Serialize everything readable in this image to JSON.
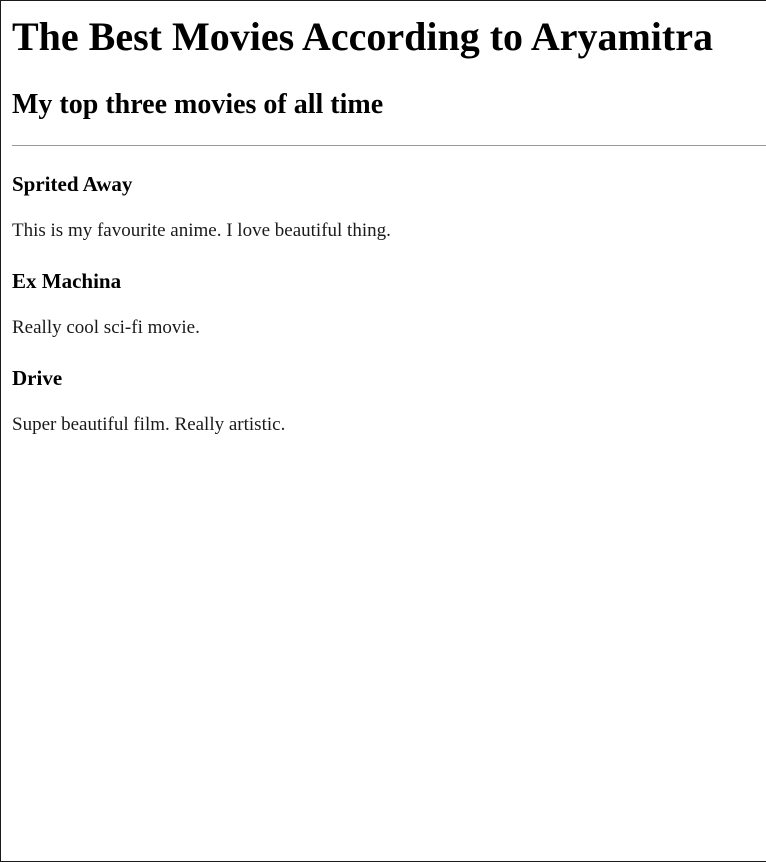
{
  "page": {
    "title": "The Best Movies According to Aryamitra",
    "subtitle": "My top three movies of all time"
  },
  "movies": [
    {
      "title": "Sprited Away",
      "description": "This is my favourite anime. I love beautiful thing."
    },
    {
      "title": "Ex Machina",
      "description": "Really cool sci-fi movie."
    },
    {
      "title": "Drive",
      "description": "Super beautiful film. Really artistic."
    }
  ]
}
